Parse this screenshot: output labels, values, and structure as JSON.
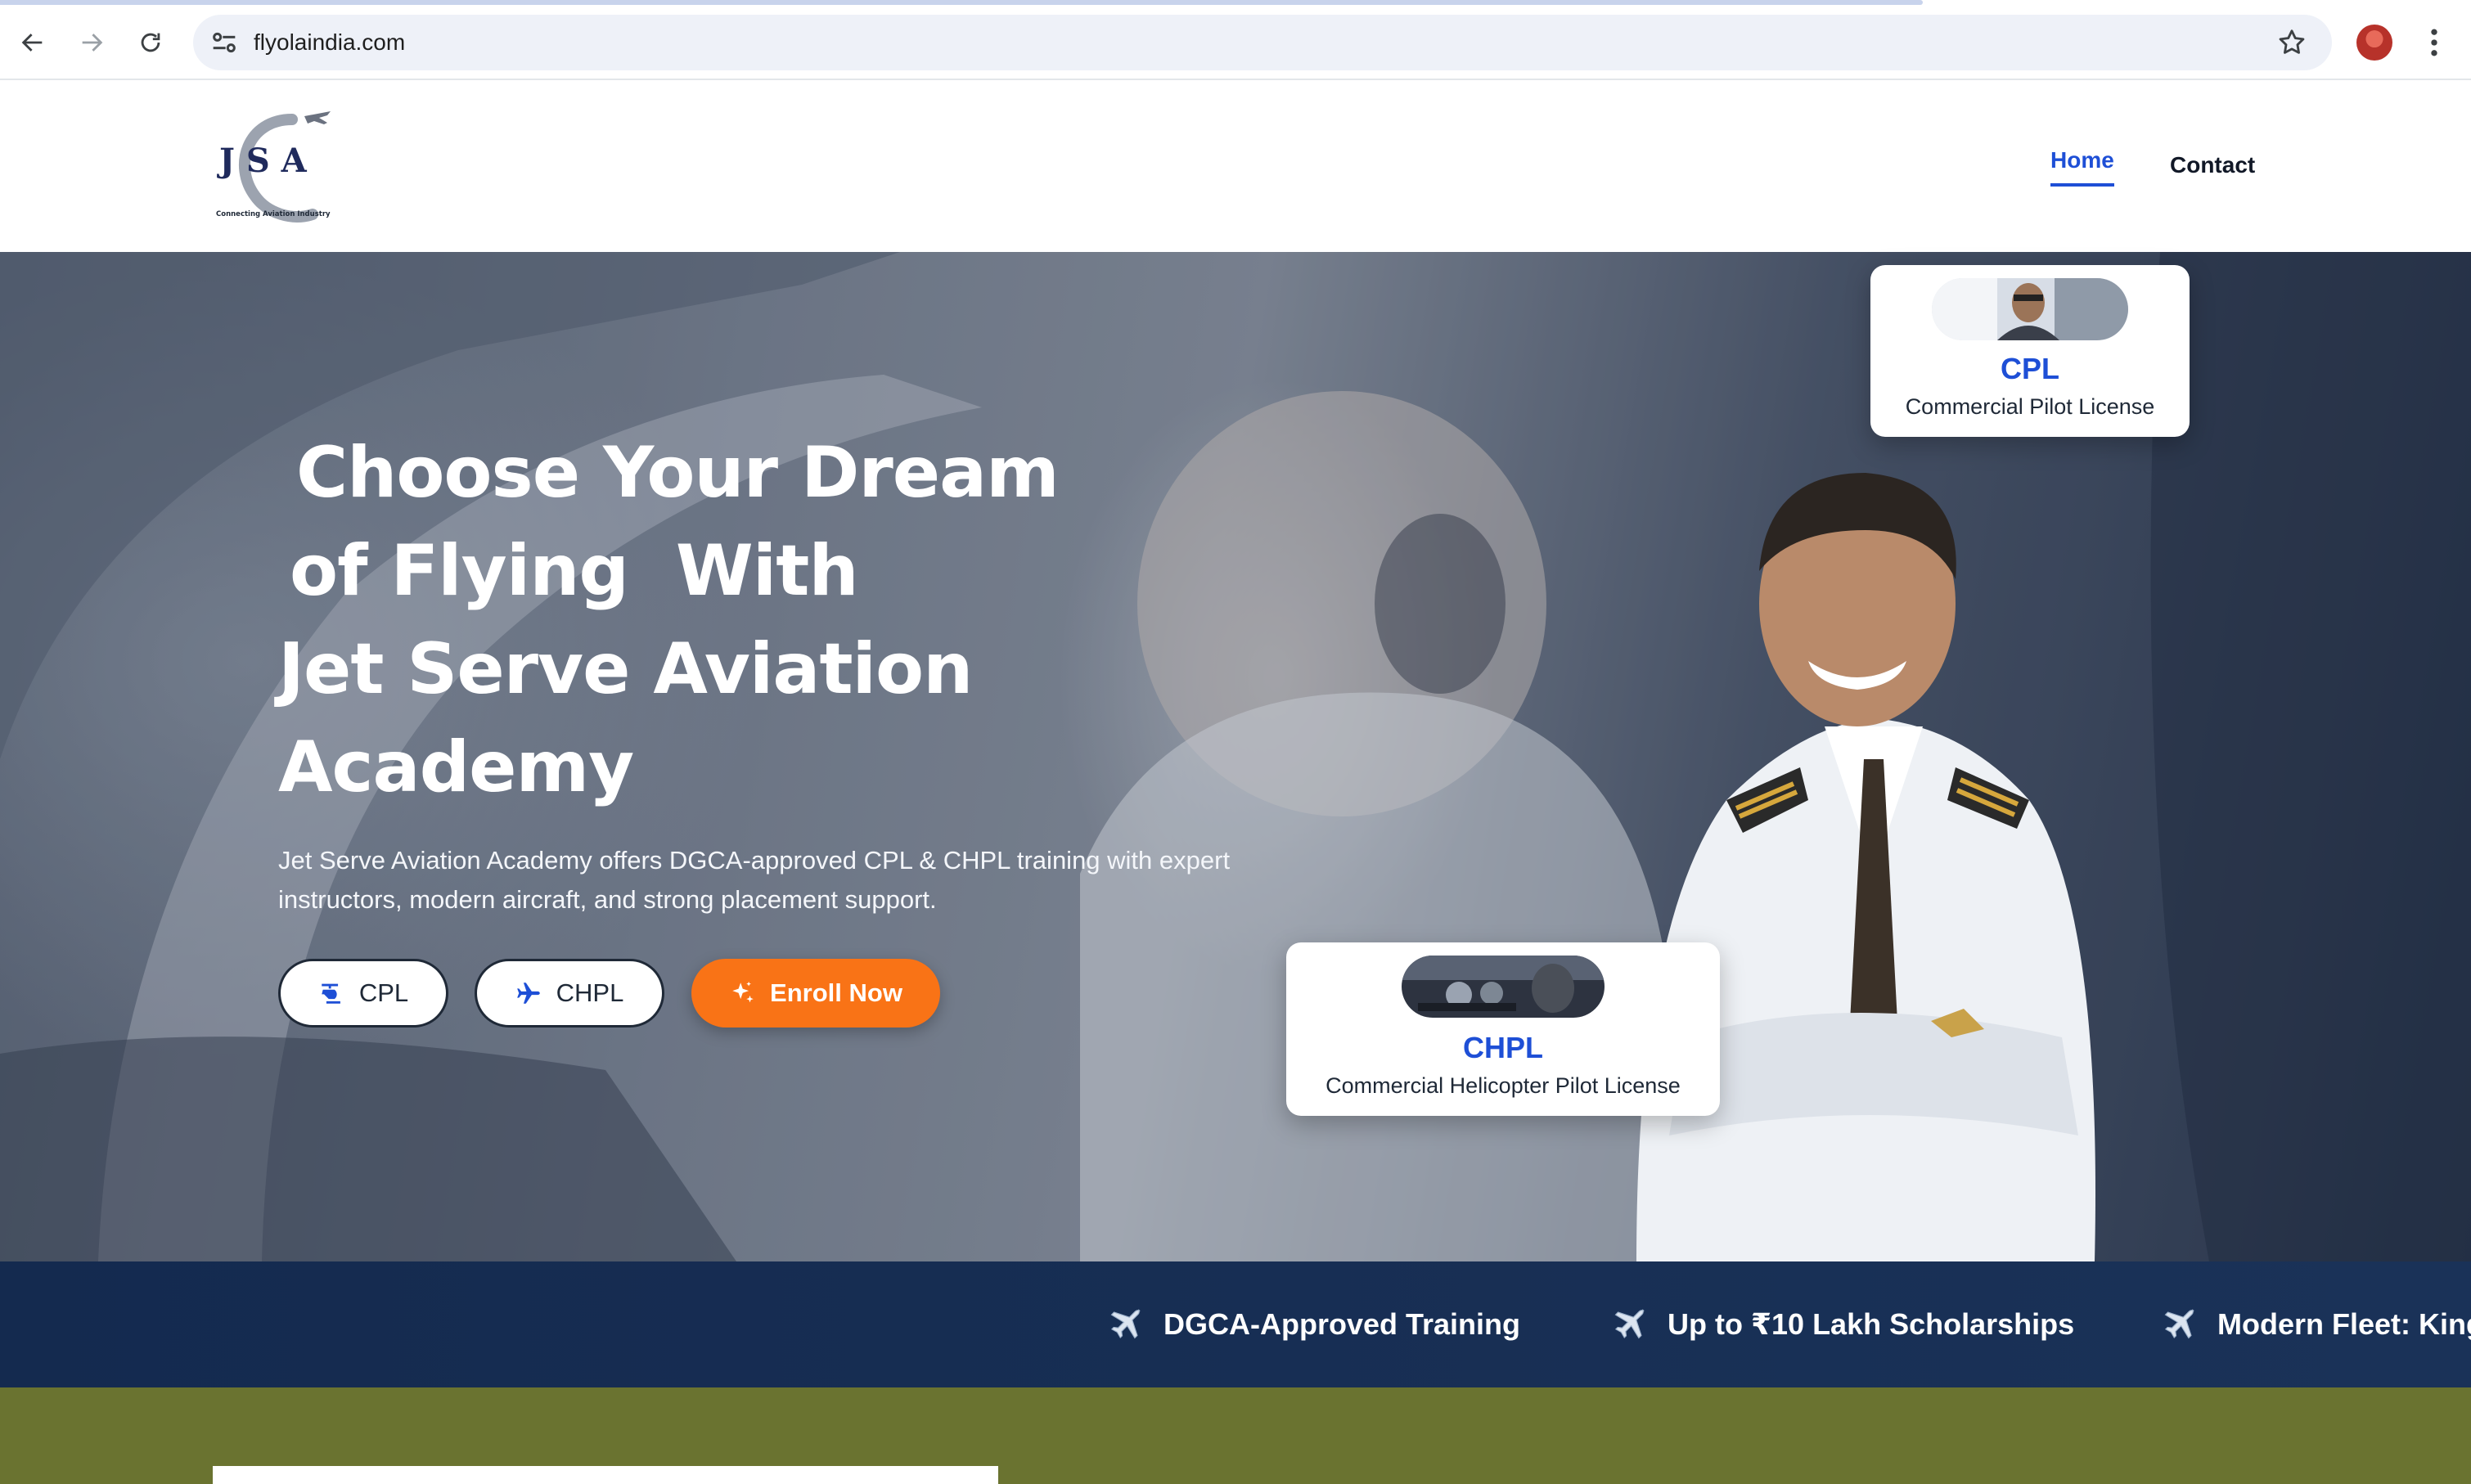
{
  "browser": {
    "url": "flyolaindia.com"
  },
  "header": {
    "logo_letters": "J S A",
    "logo_tagline": "Connecting Aviation Industry",
    "nav": {
      "home": "Home",
      "contact": "Contact"
    }
  },
  "hero": {
    "headline_line1": "Choose Your Dream",
    "headline_line2": "of Flying  With",
    "headline_line3": "Jet Serve Aviation",
    "headline_line4": "Academy",
    "lead": "Jet Serve Aviation Academy offers DGCA-approved CPL & CHPL training with expert instructors, modern aircraft, and strong placement support.",
    "buttons": {
      "cpl": "CPL",
      "chpl": "CHPL",
      "enroll": "Enroll Now"
    },
    "cards": {
      "cpl": {
        "code": "CPL",
        "title": "Commercial Pilot License"
      },
      "chpl": {
        "code": "CHPL",
        "title": "Commercial Helicopter Pilot License"
      }
    }
  },
  "ticker": {
    "items": [
      "DGCA-Approved Training",
      "Up to ₹10 Lakh Scholarships",
      "Modern Fleet: King"
    ]
  },
  "colors": {
    "accent_blue": "#1e4fd6",
    "enroll_orange": "#f97316",
    "ticker_navy": "#142a4f",
    "section_green": "#6a7330"
  }
}
